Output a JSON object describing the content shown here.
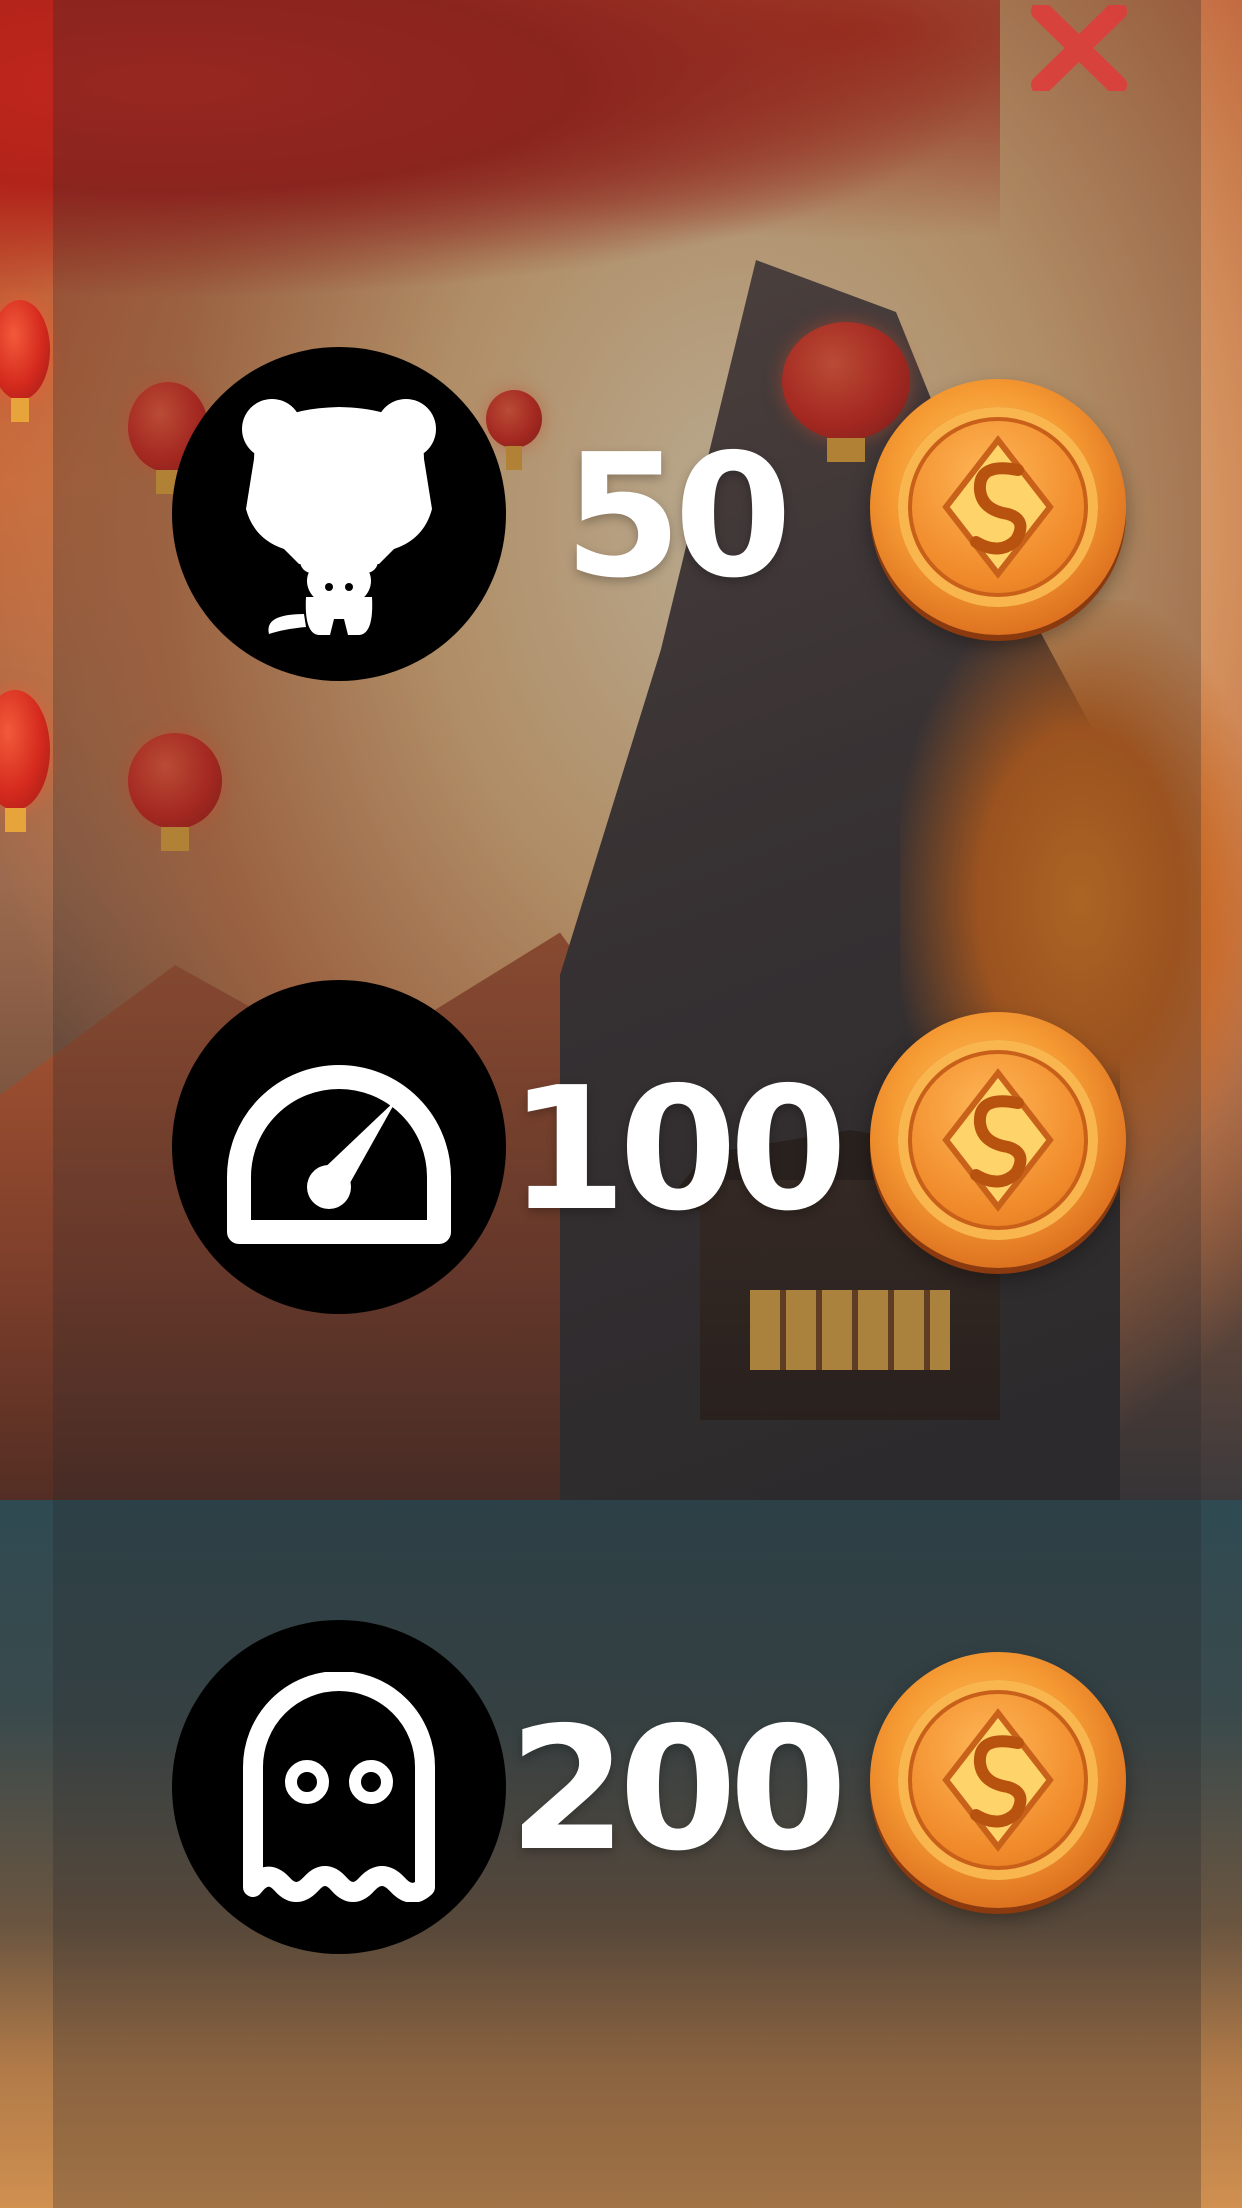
{
  "screen": {
    "accent_white": "#ffffff",
    "close_color": "#e23a3a",
    "coin_color": "#f59a33"
  },
  "close": {
    "icon": "close-icon"
  },
  "shop_items": [
    {
      "icon": "character-silhouette-icon",
      "price": "50",
      "currency_icon": "coin-icon"
    },
    {
      "icon": "speedometer-icon",
      "price": "100",
      "currency_icon": "coin-icon"
    },
    {
      "icon": "ghost-icon",
      "price": "200",
      "currency_icon": "coin-icon"
    }
  ]
}
